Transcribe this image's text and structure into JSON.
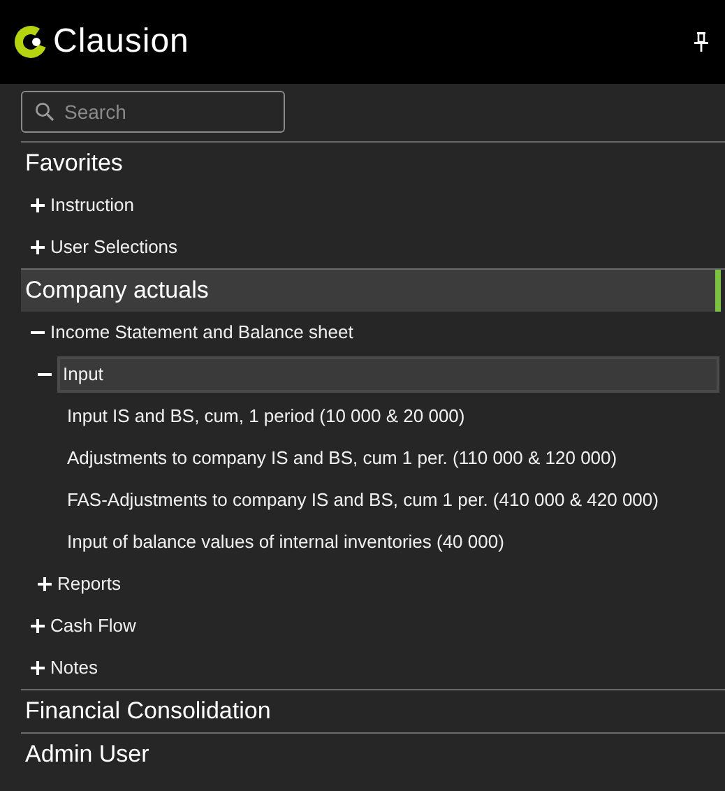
{
  "header": {
    "logo": "Clausion"
  },
  "search": {
    "placeholder": "Search"
  },
  "sections": [
    {
      "title": "Favorites",
      "selected": false,
      "children": [
        {
          "label": "Instruction",
          "expanded": false,
          "selected": false
        },
        {
          "label": "User Selections",
          "expanded": false,
          "selected": false
        }
      ]
    },
    {
      "title": "Company actuals",
      "selected": true,
      "children": [
        {
          "label": "Income Statement and Balance sheet",
          "expanded": true,
          "selected": false,
          "children": [
            {
              "label": "Input",
              "expanded": true,
              "selected": true,
              "children": [
                {
                  "label": "Input IS and BS, cum, 1 period (10 000 & 20 000)",
                  "kind": "leaf",
                  "selected": false
                },
                {
                  "label": "Adjustments to company IS and BS, cum 1 per. (110 000 & 120 000)",
                  "kind": "leaf",
                  "selected": false
                },
                {
                  "label": "FAS-Adjustments to company IS and BS, cum 1 per. (410 000 & 420 000)",
                  "kind": "leaf",
                  "selected": false
                },
                {
                  "label": "Input of balance values of internal inventories (40 000)",
                  "kind": "leaf",
                  "selected": false
                }
              ]
            },
            {
              "label": "Reports",
              "expanded": false,
              "selected": false
            }
          ]
        },
        {
          "label": "Cash Flow",
          "expanded": false,
          "selected": false
        },
        {
          "label": "Notes",
          "expanded": false,
          "selected": false
        }
      ]
    },
    {
      "title": "Financial Consolidation",
      "selected": false
    },
    {
      "title": "Admin User",
      "selected": false
    }
  ]
}
